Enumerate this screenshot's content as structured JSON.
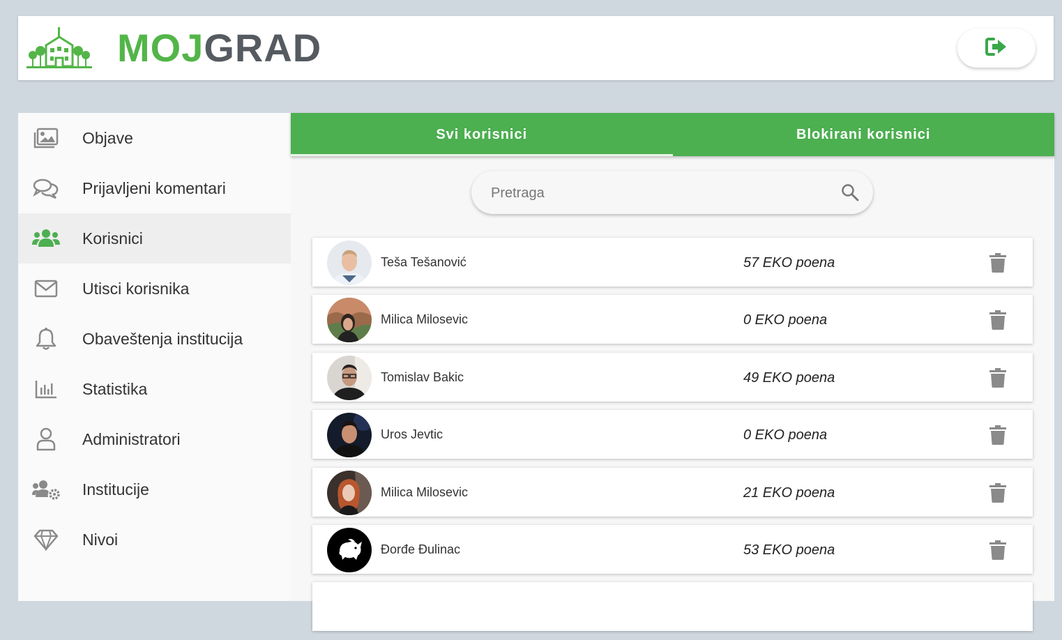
{
  "header": {
    "brand_moj": "MOJ",
    "brand_grad": "GRAD",
    "logout_icon": "sign-out-icon",
    "colors": {
      "brand_green": "#53b548",
      "brand_gray": "#555b60"
    }
  },
  "sidebar": {
    "items": [
      {
        "label": "Objave",
        "icon": "images-icon",
        "active": false
      },
      {
        "label": "Prijavljeni komentari",
        "icon": "comments-icon",
        "active": false
      },
      {
        "label": "Korisnici",
        "icon": "users-icon",
        "active": true
      },
      {
        "label": "Utisci korisnika",
        "icon": "envelope-icon",
        "active": false
      },
      {
        "label": "Obaveštenja institucija",
        "icon": "bell-icon",
        "active": false
      },
      {
        "label": "Statistika",
        "icon": "chart-bar-icon",
        "active": false
      },
      {
        "label": "Administratori",
        "icon": "user-icon",
        "active": false
      },
      {
        "label": "Institucije",
        "icon": "users-cog-icon",
        "active": false
      },
      {
        "label": "Nivoi",
        "icon": "gem-icon",
        "active": false
      }
    ]
  },
  "tabs": [
    {
      "label": "Svi korisnici",
      "active": true
    },
    {
      "label": "Blokirani korisnici",
      "active": false
    }
  ],
  "search": {
    "placeholder": "Pretraga",
    "value": "",
    "icon": "search-icon"
  },
  "users": [
    {
      "name": "Teša Tešanović",
      "points": "57 EKO poena"
    },
    {
      "name": "Milica Milosevic",
      "points": "0 EKO poena"
    },
    {
      "name": "Tomislav Bakic",
      "points": "49 EKO poena"
    },
    {
      "name": "Uros Jevtic",
      "points": "0 EKO poena"
    },
    {
      "name": "Milica Milosevic",
      "points": "21 EKO poena"
    },
    {
      "name": "Đorđe Đulinac",
      "points": "53 EKO poena"
    }
  ],
  "colors": {
    "accent": "#4caf50",
    "icon_gray": "#8a8a8a"
  }
}
